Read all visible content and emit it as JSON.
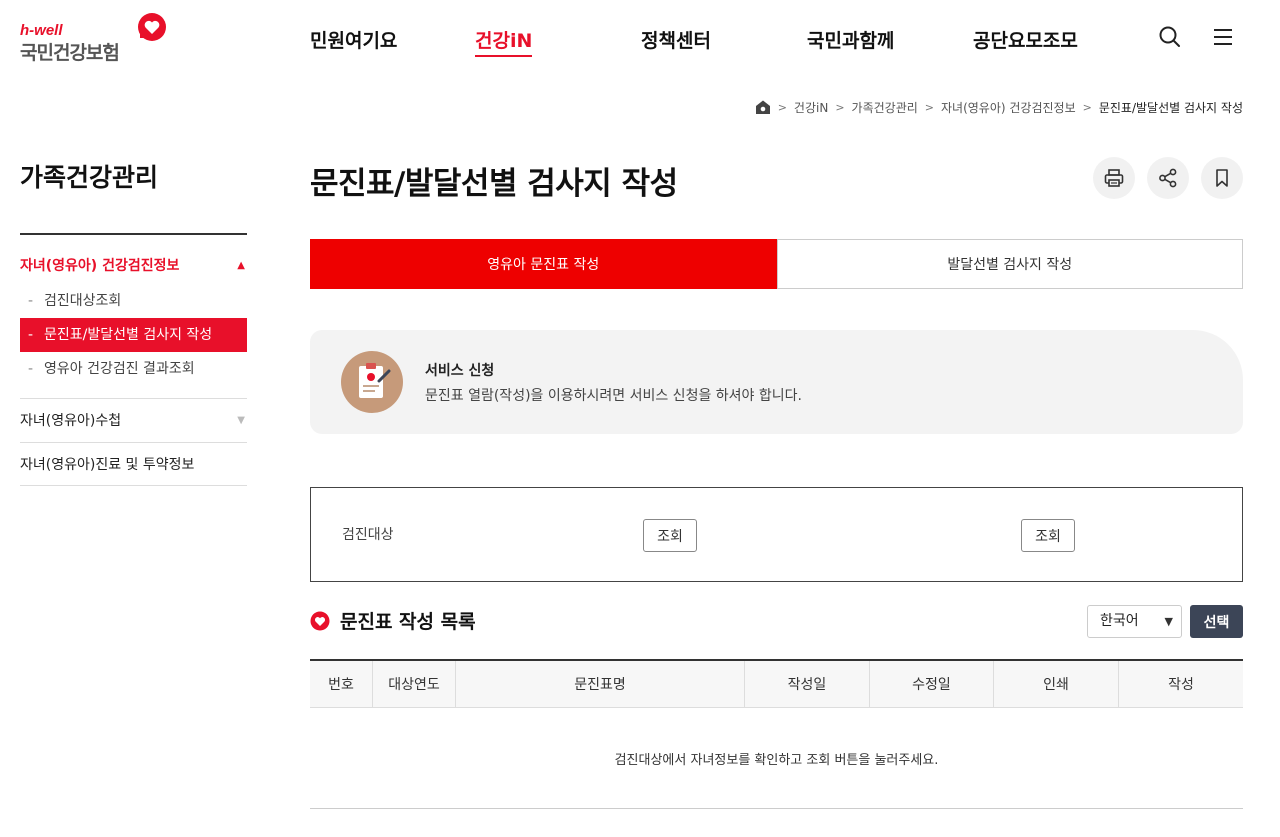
{
  "header": {
    "logo_sub": "h-well",
    "logo_main": "국민건강보험",
    "nav": [
      "민원여기요",
      "건강iN",
      "정책센터",
      "국민과함께",
      "공단요모조모"
    ],
    "active_nav_index": 1
  },
  "breadcrumb": {
    "items": [
      "건강iN",
      "가족건강관리",
      "자녀(영유아) 건강검진정보",
      "문진표/발달선별 검사지 작성"
    ]
  },
  "sidebar": {
    "title": "가족건강관리",
    "section_open": "자녀(영유아) 건강검진정보",
    "sub_items": [
      "검진대상조회",
      "문진표/발달선별 검사지 작성",
      "영유아 건강검진 결과조회"
    ],
    "other_sections": [
      "자녀(영유아)수첩",
      "자녀(영유아)진료 및 투약정보"
    ]
  },
  "page": {
    "title": "문진표/발달선별 검사지 작성"
  },
  "tabs": {
    "items": [
      "영유아 문진표 작성",
      "발달선별 검사지 작성"
    ],
    "active_index": 0
  },
  "notice": {
    "title": "서비스 신청",
    "desc": "문진표 열람(작성)을 이용하시려면 서비스 신청을 하셔야 합니다."
  },
  "search": {
    "label": "검진대상",
    "button1": "조회",
    "button2": "조회"
  },
  "list": {
    "title": "문진표 작성 목록",
    "language": "한국어",
    "select_button": "선택",
    "columns": [
      "번호",
      "대상연도",
      "문진표명",
      "작성일",
      "수정일",
      "인쇄",
      "작성"
    ],
    "empty_message": "검진대상에서 자녀정보를 확인하고 조회 버튼을 눌러주세요."
  },
  "colors": {
    "brand_red": "#e8102a",
    "tab_red": "#ee0000",
    "dark_button": "#3c4557"
  },
  "icons": [
    "heart-logo-icon",
    "search-icon",
    "menu-icon",
    "home-icon",
    "print-icon",
    "share-icon",
    "bookmark-icon",
    "clipboard-icon",
    "heart-icon"
  ]
}
